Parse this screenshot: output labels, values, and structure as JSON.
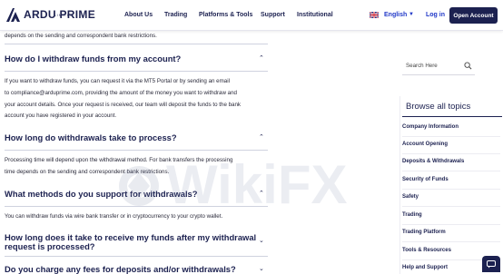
{
  "nav": {
    "logo_text": "ARDU PRIME",
    "logo_sub": "LIMITED",
    "items": [
      {
        "label": "About Us",
        "has_dropdown": false
      },
      {
        "label": "Trading",
        "has_dropdown": false
      },
      {
        "label": "Platforms & Tools",
        "has_dropdown": false
      },
      {
        "label": "Support",
        "has_dropdown": false
      },
      {
        "label": "Institutional",
        "has_dropdown": false
      }
    ],
    "language": "English",
    "login": "Log in",
    "open_account": "Open Account"
  },
  "faq": {
    "intro_tail": "depends on the sending and correspondent bank restrictions.",
    "items": [
      {
        "question": "How do I withdraw funds from my account?",
        "answer_lines": [
          "If you want to withdraw funds, you can request it via the MT5 Portal or by sending an email",
          "to compliance@arduprime.com, providing the amount of the money you want to withdraw and",
          "your account details. Once your request is received, our team will deposit the funds to the bank",
          "account you have registered in your account."
        ]
      },
      {
        "question": "How long do withdrawals take to process?",
        "answer_lines": [
          "Processing time will depend upon the withdrawal method. For bank transfers the processing",
          "time depends on the sending and correspondent bank restrictions."
        ]
      },
      {
        "question": "What methods do you support for withdrawals?",
        "answer_lines": [
          "You can withdraw funds via wire bank transfer or in cryptocurrency to your crypto wallet."
        ]
      },
      {
        "question_lines": [
          "How long does it take to receive my funds after my withdrawal",
          "request is processed?"
        ]
      },
      {
        "question": "Do you charge any fees for deposits and/or withdrawals?"
      }
    ]
  },
  "sidebar": {
    "search_placeholder": "Search Here",
    "topics_title": "Browse all topics",
    "topics": [
      "Company Information",
      "Account Opening",
      "Deposits & Withdrawals",
      "Security of Funds",
      "Safety",
      "Trading",
      "Trading Platform",
      "Tools & Resources",
      "Help and Support"
    ]
  },
  "watermark": "WikiFX",
  "colors": {
    "navy": "#1c2150",
    "link_blue": "#2038c8"
  }
}
